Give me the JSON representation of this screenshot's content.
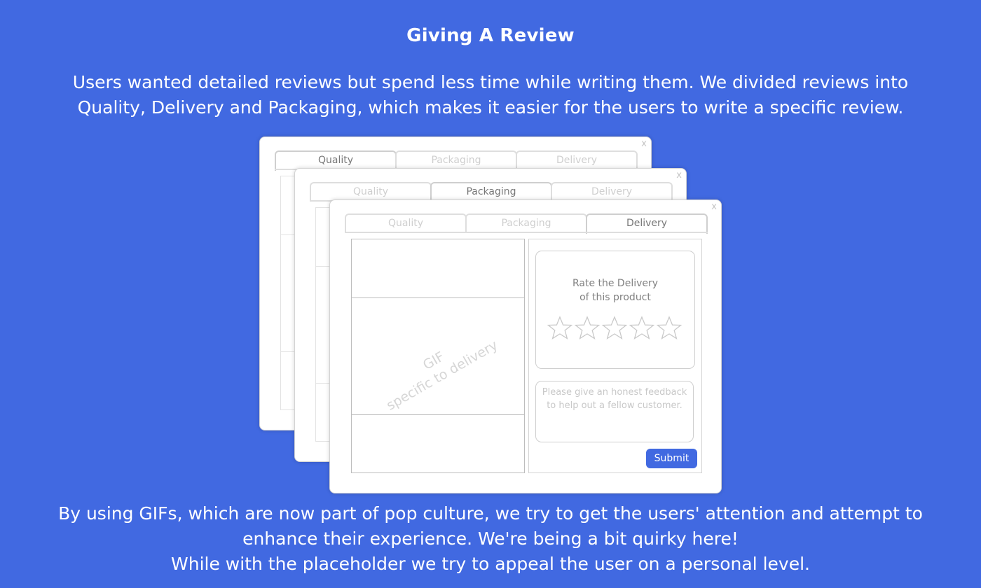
{
  "page": {
    "title": "Giving A Review",
    "intro_line1": "Users wanted detailed reviews but spend less time while writing them. We divided reviews into",
    "intro_line2": "Quality, Delivery and Packaging, which makes it easier for the users to write a specific review.",
    "outro_line1": "By using GIFs, which are now part of pop culture, we try to get the users' attention and attempt to",
    "outro_line2": "enhance their experience. We're being a bit quirky here!",
    "outro_line3": "While with the placeholder we try to appeal the user on a personal level."
  },
  "colors": {
    "background": "#4169e1",
    "accent": "#4169e1",
    "window": "#ffffff"
  },
  "windows": {
    "close_label": "x",
    "tabs": [
      "Quality",
      "Packaging",
      "Delivery"
    ],
    "quality": {
      "active_tab": "Quality"
    },
    "packaging": {
      "active_tab": "Packaging"
    },
    "delivery": {
      "active_tab": "Delivery",
      "gif_line1": "GIF",
      "gif_line2": "specific to delivery",
      "rate_line1": "Rate the Delivery",
      "rate_line2": "of this product",
      "star_icon": "star-outline-icon",
      "rating": {
        "value": 0,
        "max": 5
      },
      "feedback_placeholder_line1": "Please give an honest feedback",
      "feedback_placeholder_line2": "to help out a fellow customer.",
      "submit_label": "Submit"
    }
  }
}
